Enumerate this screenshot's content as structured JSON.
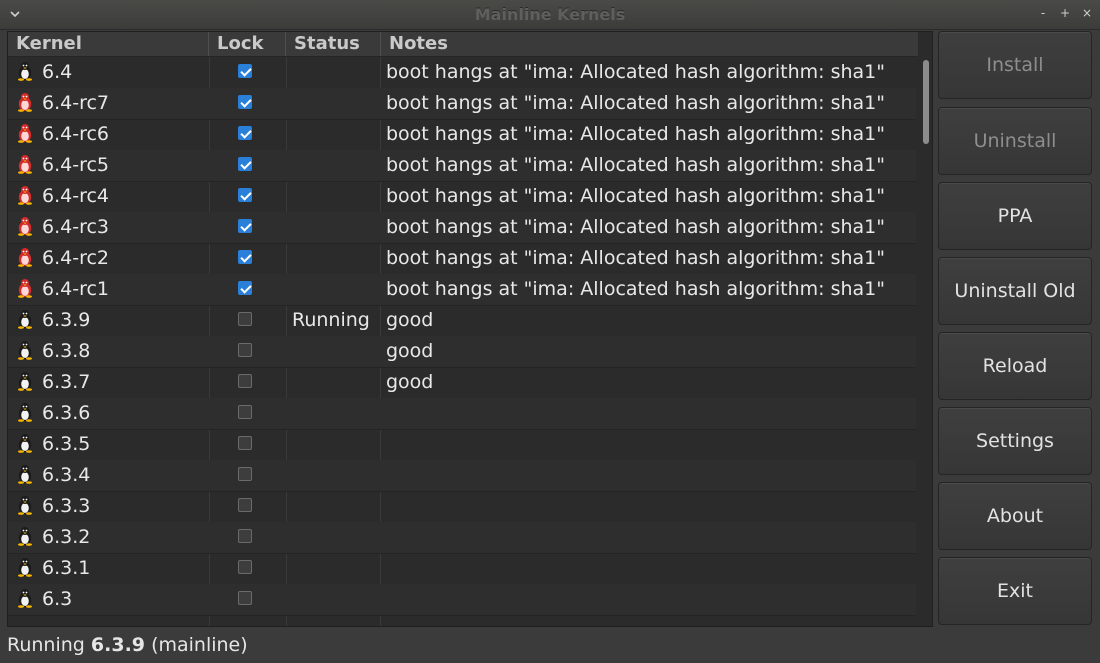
{
  "window": {
    "title": "Mainline Kernels",
    "menu_icon": "chevron-down-icon",
    "controls": [
      "-",
      "+",
      "×"
    ]
  },
  "table": {
    "columns": [
      "Kernel",
      "Lock",
      "Status",
      "Notes"
    ],
    "rows": [
      {
        "kernel": "6.4",
        "icon": "tux-icon",
        "locked": true,
        "status": "",
        "notes": "boot hangs at \"ima: Allocated hash algorithm: sha1\""
      },
      {
        "kernel": "6.4-rc7",
        "icon": "tux-rc-icon",
        "locked": true,
        "status": "",
        "notes": "boot hangs at \"ima: Allocated hash algorithm: sha1\""
      },
      {
        "kernel": "6.4-rc6",
        "icon": "tux-rc-icon",
        "locked": true,
        "status": "",
        "notes": "boot hangs at \"ima: Allocated hash algorithm: sha1\""
      },
      {
        "kernel": "6.4-rc5",
        "icon": "tux-rc-icon",
        "locked": true,
        "status": "",
        "notes": "boot hangs at \"ima: Allocated hash algorithm: sha1\""
      },
      {
        "kernel": "6.4-rc4",
        "icon": "tux-rc-icon",
        "locked": true,
        "status": "",
        "notes": "boot hangs at \"ima: Allocated hash algorithm: sha1\""
      },
      {
        "kernel": "6.4-rc3",
        "icon": "tux-rc-icon",
        "locked": true,
        "status": "",
        "notes": "boot hangs at \"ima: Allocated hash algorithm: sha1\""
      },
      {
        "kernel": "6.4-rc2",
        "icon": "tux-rc-icon",
        "locked": true,
        "status": "",
        "notes": "boot hangs at \"ima: Allocated hash algorithm: sha1\""
      },
      {
        "kernel": "6.4-rc1",
        "icon": "tux-rc-icon",
        "locked": true,
        "status": "",
        "notes": "boot hangs at \"ima: Allocated hash algorithm: sha1\""
      },
      {
        "kernel": "6.3.9",
        "icon": "tux-icon",
        "locked": false,
        "status": "Running",
        "notes": "good"
      },
      {
        "kernel": "6.3.8",
        "icon": "tux-icon",
        "locked": false,
        "status": "",
        "notes": "good"
      },
      {
        "kernel": "6.3.7",
        "icon": "tux-icon",
        "locked": false,
        "status": "",
        "notes": "good"
      },
      {
        "kernel": "6.3.6",
        "icon": "tux-icon",
        "locked": false,
        "status": "",
        "notes": ""
      },
      {
        "kernel": "6.3.5",
        "icon": "tux-icon",
        "locked": false,
        "status": "",
        "notes": ""
      },
      {
        "kernel": "6.3.4",
        "icon": "tux-icon",
        "locked": false,
        "status": "",
        "notes": ""
      },
      {
        "kernel": "6.3.3",
        "icon": "tux-icon",
        "locked": false,
        "status": "",
        "notes": ""
      },
      {
        "kernel": "6.3.2",
        "icon": "tux-icon",
        "locked": false,
        "status": "",
        "notes": ""
      },
      {
        "kernel": "6.3.1",
        "icon": "tux-icon",
        "locked": false,
        "status": "",
        "notes": ""
      },
      {
        "kernel": "6.3",
        "icon": "tux-icon",
        "locked": false,
        "status": "",
        "notes": ""
      }
    ]
  },
  "buttons": {
    "install": "Install",
    "uninstall": "Uninstall",
    "ppa": "PPA",
    "uninstall_old": "Uninstall Old",
    "reload": "Reload",
    "settings": "Settings",
    "about": "About",
    "exit": "Exit"
  },
  "statusbar": {
    "prefix": "Running",
    "version": "6.3.9",
    "suffix": "(mainline)"
  },
  "colors": {
    "check_accent": "#2a7fd8",
    "rc_icon": "#d22b2b"
  }
}
